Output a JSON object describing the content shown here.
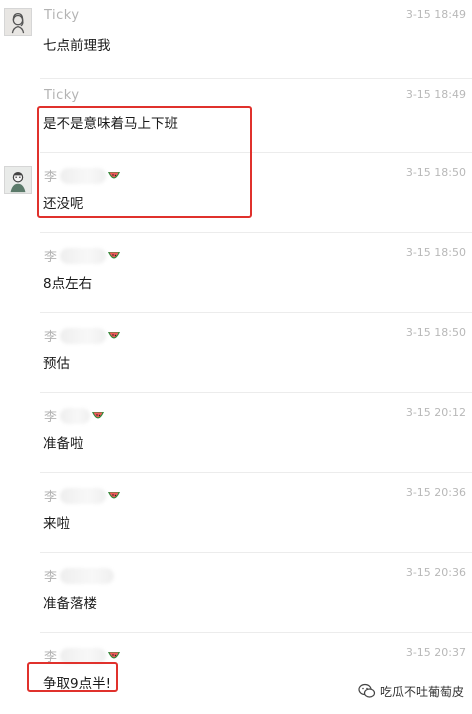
{
  "messages": [
    {
      "sender": "Ticky",
      "time": "3-15 18:49",
      "text": "七点前理我"
    },
    {
      "sender": "Ticky",
      "time": "3-15 18:49",
      "text": "是不是意味着马上下班"
    },
    {
      "sender": "李",
      "time": "3-15 18:50",
      "text": "还没呢"
    },
    {
      "sender": "李",
      "time": "3-15 18:50",
      "text": "8点左右"
    },
    {
      "sender": "李",
      "time": "3-15 18:50",
      "text": "预估"
    },
    {
      "sender": "李",
      "time": "3-15 20:12",
      "text": "准备啦"
    },
    {
      "sender": "李",
      "time": "3-15 20:36",
      "text": "来啦"
    },
    {
      "sender": "李",
      "time": "3-15 20:36",
      "text": "准备落楼"
    },
    {
      "sender": "李",
      "time": "3-15 20:37",
      "text": "争取9点半!"
    }
  ],
  "watermark": {
    "text": "吃瓜不吐葡萄皮",
    "icon": "wechat-icon"
  },
  "colors": {
    "highlight": "#e0312c",
    "sender": "#b3b3b3",
    "time": "#b8b8b8"
  }
}
